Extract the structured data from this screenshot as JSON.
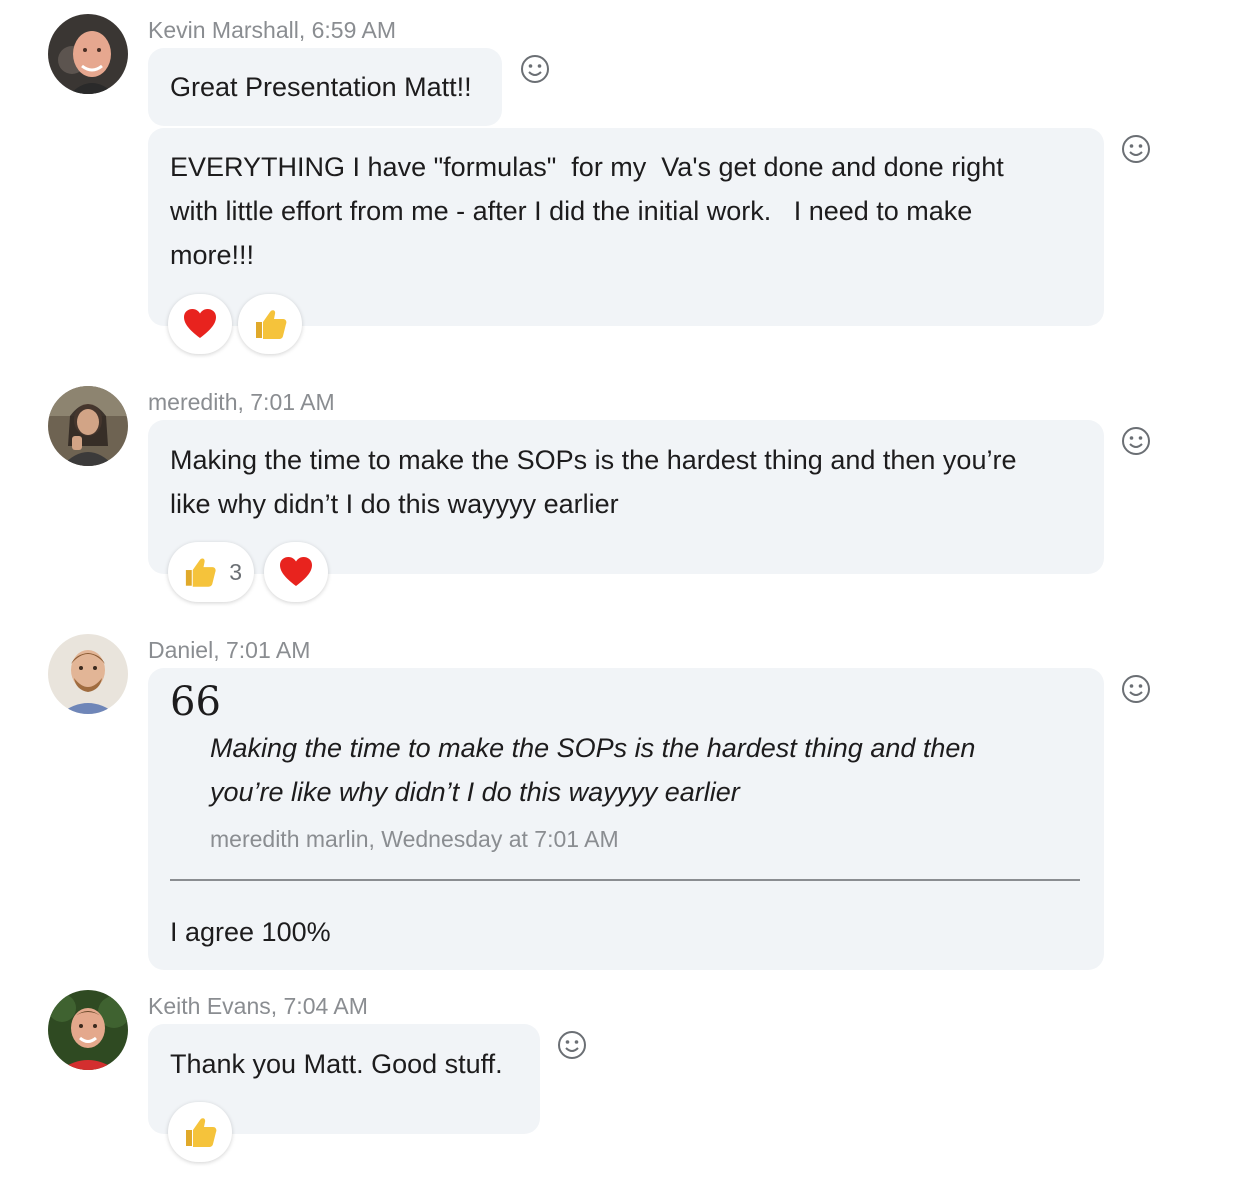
{
  "messages": [
    {
      "author": "Kevin Marshall",
      "meta": "Kevin Marshall, 6:59 AM",
      "text1": "Great Presentation Matt!!",
      "text2": "EVERYTHING I have \"formulas\"  for my  Va's get done and done right\nwith little effort from me - after I did the initial work.   I need to make\nmore!!!",
      "reactions": [
        {
          "icon": "heart-icon"
        },
        {
          "icon": "thumbs-up-icon"
        }
      ]
    },
    {
      "author": "meredith",
      "meta": "meredith, 7:01 AM",
      "text": "Making the time to make the SOPs is the hardest thing and then you’re\nlike why didn’t I do this wayyyy earlier",
      "reactions": [
        {
          "icon": "thumbs-up-icon",
          "count": "3"
        },
        {
          "icon": "heart-icon"
        }
      ]
    },
    {
      "author": "Daniel",
      "meta": "Daniel, 7:01 AM",
      "quote_mark": "66",
      "quote_text": "Making the time to make the SOPs is the hardest thing and then\nyou’re like why didn’t I do this wayyyy earlier",
      "quote_attribution": "meredith marlin, Wednesday at 7:01 AM",
      "text": "I agree 100%"
    },
    {
      "author": "Keith Evans",
      "meta": "Keith Evans, 7:04 AM",
      "text": "Thank you Matt. Good stuff.",
      "reactions": [
        {
          "icon": "thumbs-up-icon"
        }
      ]
    }
  ],
  "colors": {
    "bubble_bg": "#f1f4f7",
    "meta_text": "#8a8d91",
    "heart": "#e8231e",
    "thumb": "#f5c33b"
  },
  "icons": {
    "add_reaction": "smiley-face-icon"
  }
}
